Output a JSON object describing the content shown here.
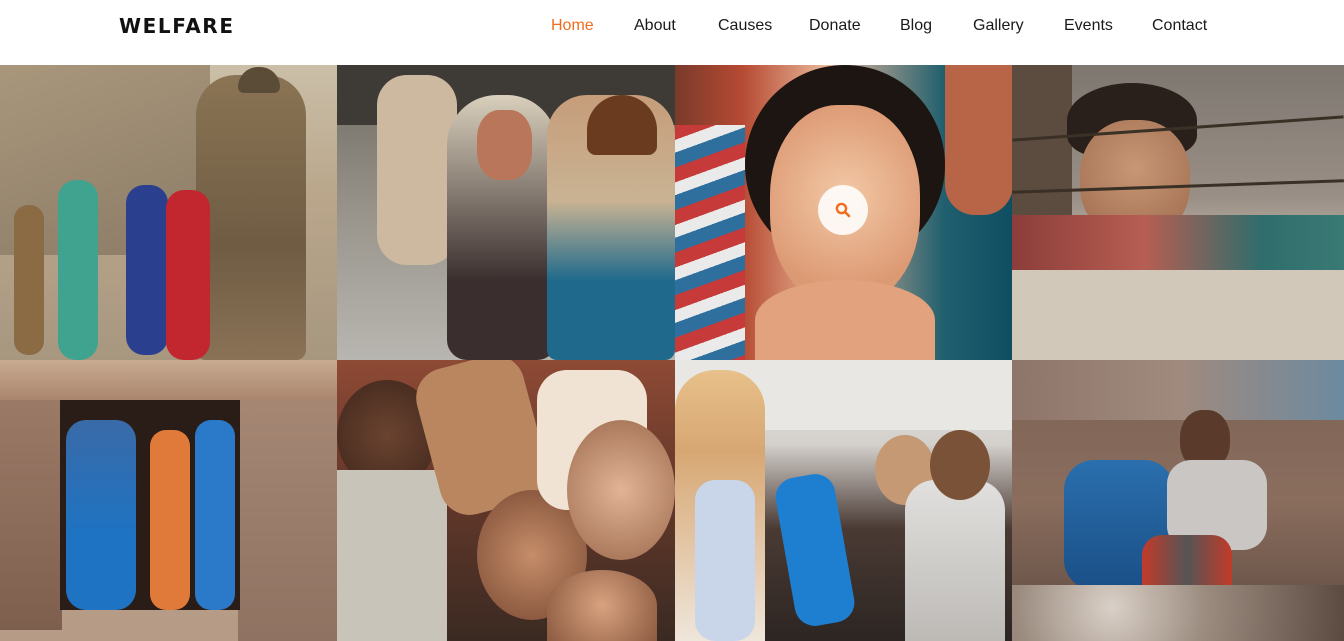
{
  "header": {
    "brand": "WELFARE",
    "nav": [
      {
        "label": "Home",
        "active": true
      },
      {
        "label": "About",
        "active": false
      },
      {
        "label": "Causes",
        "active": false
      },
      {
        "label": "Donate",
        "active": false
      },
      {
        "label": "Blog",
        "active": false
      },
      {
        "label": "Gallery",
        "active": false
      },
      {
        "label": "Events",
        "active": false
      },
      {
        "label": "Contact",
        "active": false
      }
    ]
  },
  "gallery": {
    "items": [
      {
        "icon": "photo-soldier-with-children"
      },
      {
        "icon": "photo-refugee-children-seated"
      },
      {
        "icon": "photo-girl-close-up",
        "overlay_icon": "search-icon"
      },
      {
        "icon": "photo-boy-behind-barbed-wire"
      },
      {
        "icon": "photo-children-in-window"
      },
      {
        "icon": "photo-children-peace-signs"
      },
      {
        "icon": "photo-aid-distribution-tent"
      },
      {
        "icon": "photo-boy-sitting-on-rocks"
      }
    ]
  },
  "colors": {
    "accent": "#f26c1e",
    "nav_text": "#1a1a1a",
    "brand": "#111111"
  }
}
